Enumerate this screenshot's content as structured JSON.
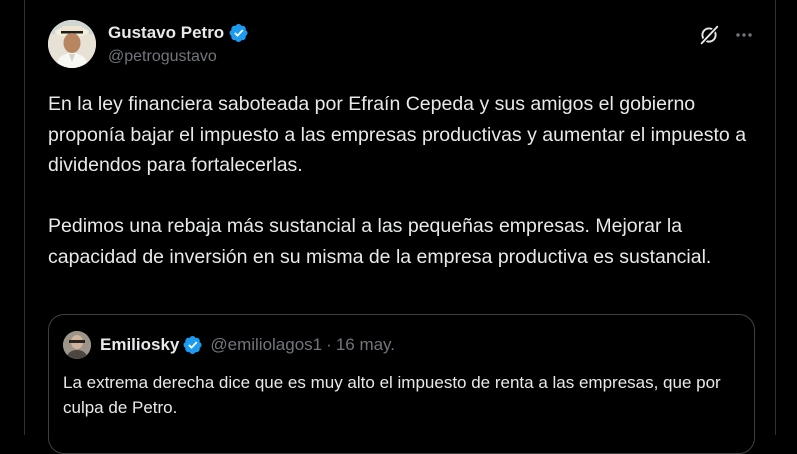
{
  "author": {
    "display_name": "Gustavo Petro",
    "handle": "@petrogustavo",
    "verified_icon": "verified-badge-icon",
    "avatar_icon": "profile-photo"
  },
  "header_actions": {
    "grok_icon": "grok-icon",
    "more_icon": "more-options-icon"
  },
  "tweet": {
    "paragraphs": [
      "En la ley financiera saboteada por Efraín Cepeda y sus amigos el gobierno proponía bajar el impuesto a las empresas productivas y aumentar el impuesto a dividendos para fortalecerlas.",
      "Pedimos una rebaja más sustancial a las pequeñas empresas. Mejorar la capacidad de inversión en su misma de la empresa productiva es sustancial."
    ]
  },
  "quoted_tweet": {
    "display_name": "Emiliosky",
    "handle": "@emiliolagos1",
    "separator": "·",
    "date": "16 may.",
    "text": "La extrema derecha dice que es muy alto el impuesto de renta a las empresas, que por culpa de Petro."
  },
  "colors": {
    "background": "#000000",
    "text_primary": "#e7e9ea",
    "text_secondary": "#71767b",
    "border": "#2f3336",
    "verified_blue": "#1d9bf0"
  }
}
